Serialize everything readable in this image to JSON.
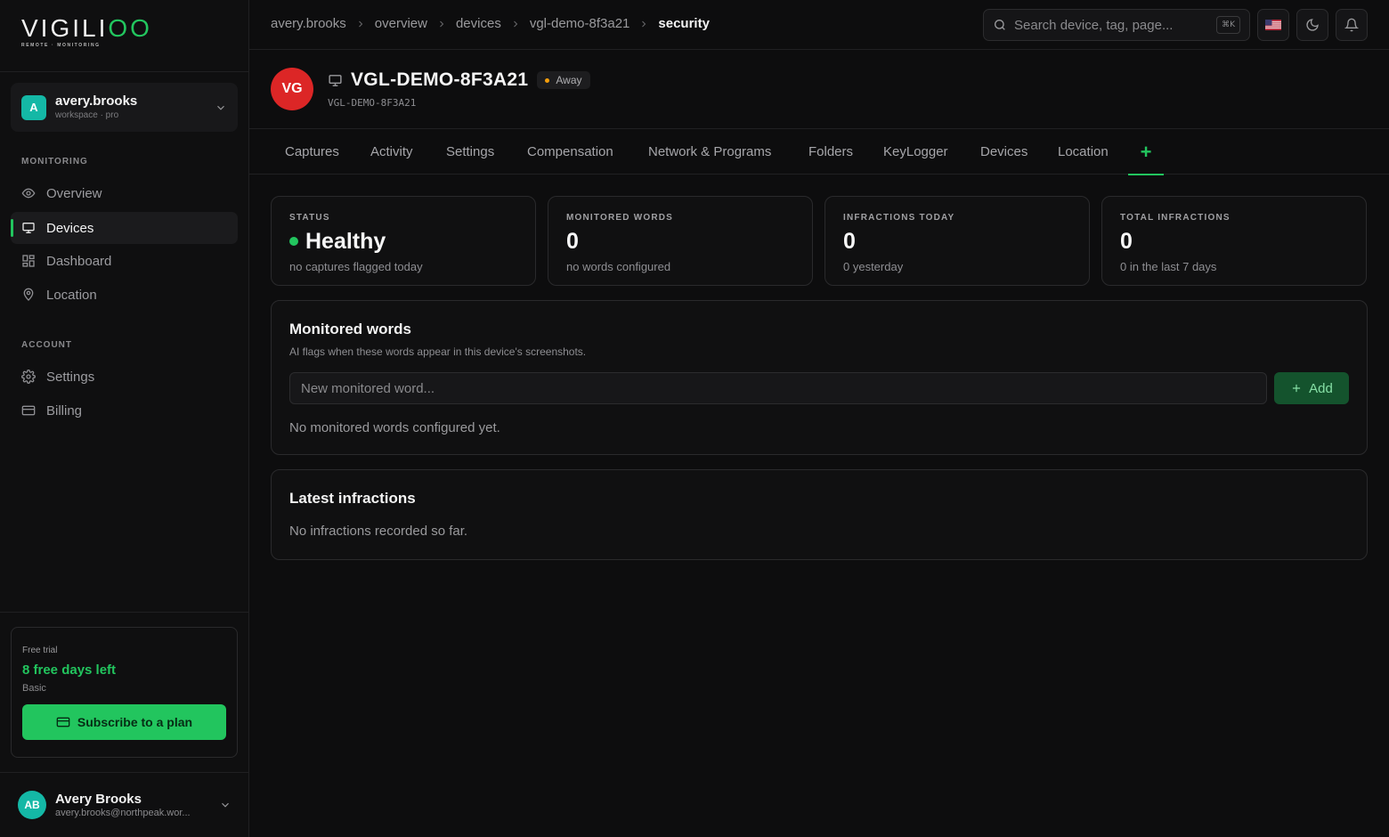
{
  "brand": {
    "name_main": "VIGILI",
    "name_accent": "OO",
    "tagline": "REMOTE · MONITORING"
  },
  "workspace": {
    "initial": "A",
    "name": "avery.brooks",
    "plan": "workspace · pro"
  },
  "sidebar": {
    "monitoring_label": "MONITORING",
    "monitoring_items": [
      {
        "label": "Overview",
        "icon": "eye-icon"
      },
      {
        "label": "Devices",
        "icon": "monitor-icon",
        "active": true
      },
      {
        "label": "Dashboard",
        "icon": "grid-icon"
      },
      {
        "label": "Location",
        "icon": "map-pin-icon"
      }
    ],
    "account_label": "ACCOUNT",
    "account_items": [
      {
        "label": "Settings",
        "icon": "gear-icon"
      },
      {
        "label": "Billing",
        "icon": "credit-card-icon"
      }
    ]
  },
  "trial": {
    "label": "Free trial",
    "days_left": "8 free days left",
    "plan": "Basic",
    "subscribe_label": "Subscribe to a plan"
  },
  "user": {
    "initials": "AB",
    "name": "Avery Brooks",
    "email": "avery.brooks@northpeak.wor..."
  },
  "breadcrumb": [
    "avery.brooks",
    "overview",
    "devices",
    "vgl-demo-8f3a21",
    "security"
  ],
  "search": {
    "placeholder": "Search device, tag, page...",
    "shortcut": "⌘K"
  },
  "device": {
    "initials": "VG",
    "name": "VGL-DEMO-8F3A21",
    "status": "Away",
    "id": "VGL-DEMO-8F3A21"
  },
  "tabs": [
    "Captures",
    "Activity",
    "Settings",
    "Compensation",
    "Network & Programs",
    "Folders",
    "KeyLogger",
    "Devices",
    "Location",
    "+"
  ],
  "stats": [
    {
      "label": "STATUS",
      "value": "Healthy",
      "sub": "no captures flagged today"
    },
    {
      "label": "MONITORED WORDS",
      "value": "0",
      "sub": "no words configured"
    },
    {
      "label": "INFRACTIONS TODAY",
      "value": "0",
      "sub": "0 yesterday"
    },
    {
      "label": "TOTAL INFRACTIONS",
      "value": "0",
      "sub": "0 in the last 7 days"
    }
  ],
  "monitored_words": {
    "title": "Monitored words",
    "description": "AI flags when these words appear in this device's screenshots.",
    "input_placeholder": "New monitored word...",
    "add_label": "Add",
    "empty": "No monitored words configured yet."
  },
  "latest_infractions": {
    "title": "Latest infractions",
    "empty": "No infractions recorded so far."
  },
  "colors": {
    "accent": "#22c55e",
    "away": "#f59e0b",
    "device_avatar": "#dc2626",
    "workspace_avatar": "#14b8a6"
  }
}
